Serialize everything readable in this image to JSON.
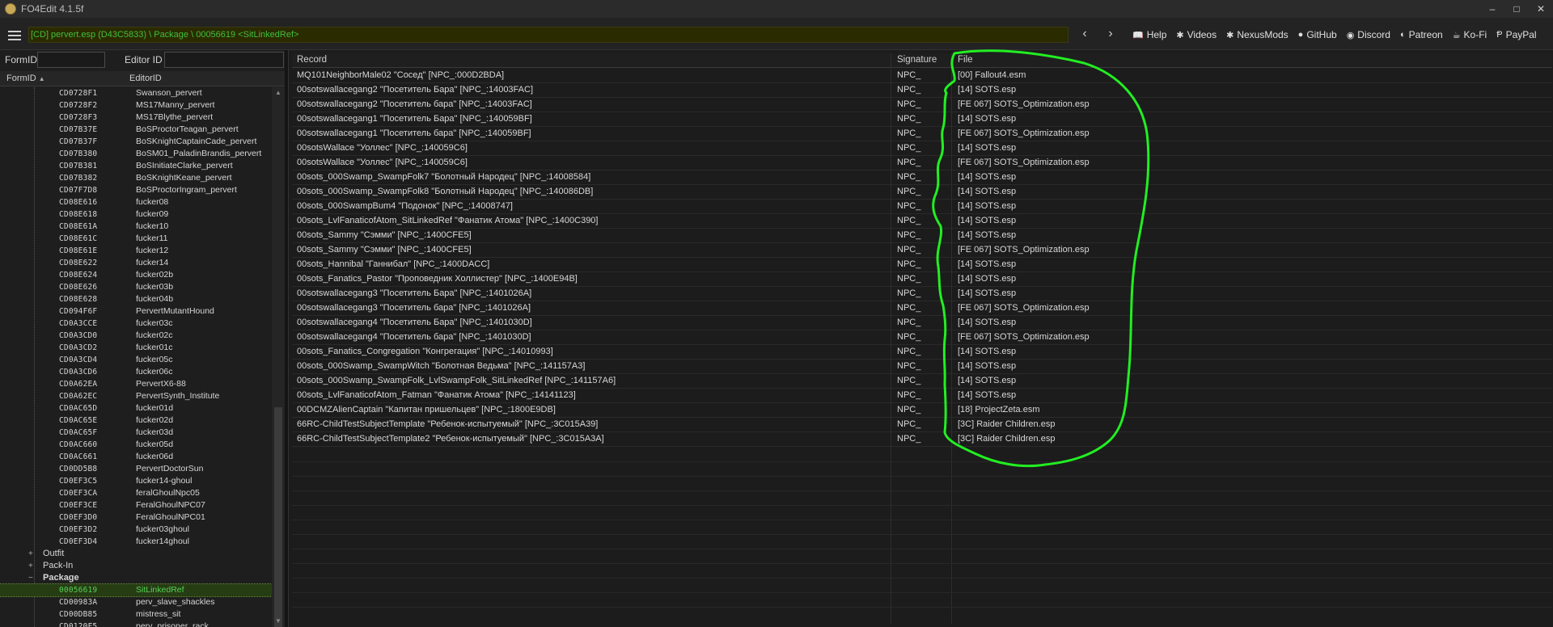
{
  "window": {
    "title": "FO4Edit 4.1.5f",
    "controls": [
      "–",
      "□",
      "✕"
    ]
  },
  "toolbar": {
    "path": "[CD] pervert.esp (D43C5833) \\ Package \\ 00056619 <SitLinkedRef>",
    "back_label": "‹",
    "forward_label": "›",
    "links": [
      {
        "label": "Help",
        "icon": "book-icon",
        "glyph": "📖"
      },
      {
        "label": "Videos",
        "icon": "video-icon",
        "glyph": "✱"
      },
      {
        "label": "NexusMods",
        "icon": "nexus-icon",
        "glyph": "✱"
      },
      {
        "label": "GitHub",
        "icon": "github-icon",
        "glyph": "●"
      },
      {
        "label": "Discord",
        "icon": "discord-icon",
        "glyph": "◉"
      },
      {
        "label": "Patreon",
        "icon": "patreon-icon",
        "glyph": "◐"
      },
      {
        "label": "Ko-Fi",
        "icon": "kofi-icon",
        "glyph": "☕"
      },
      {
        "label": "PayPal",
        "icon": "paypal-icon",
        "glyph": "Ᵽ"
      }
    ]
  },
  "filter": {
    "formid_label": "FormID",
    "editorid_label": "Editor ID",
    "formid_value": "",
    "editorid_value": ""
  },
  "tree": {
    "columns": [
      "FormID",
      "EditorID"
    ],
    "sort_glyph": "▲",
    "rows": [
      {
        "type": "rec",
        "fid": "CD0728F1",
        "eid": "Swanson_pervert"
      },
      {
        "type": "rec",
        "fid": "CD0728F2",
        "eid": "MS17Manny_pervert"
      },
      {
        "type": "rec",
        "fid": "CD0728F3",
        "eid": "MS17Blythe_pervert"
      },
      {
        "type": "rec",
        "fid": "CD07B37E",
        "eid": "BoSProctorTeagan_pervert"
      },
      {
        "type": "rec",
        "fid": "CD07B37F",
        "eid": "BoSKnightCaptainCade_pervert"
      },
      {
        "type": "rec",
        "fid": "CD07B380",
        "eid": "BoSM01_PaladinBrandis_pervert"
      },
      {
        "type": "rec",
        "fid": "CD07B381",
        "eid": "BoSInitiateClarke_pervert"
      },
      {
        "type": "rec",
        "fid": "CD07B382",
        "eid": "BoSKnightKeane_pervert"
      },
      {
        "type": "rec",
        "fid": "CD07F7D8",
        "eid": "BoSProctorIngram_pervert"
      },
      {
        "type": "rec",
        "fid": "CD08E616",
        "eid": "fucker08"
      },
      {
        "type": "rec",
        "fid": "CD08E618",
        "eid": "fucker09"
      },
      {
        "type": "rec",
        "fid": "CD08E61A",
        "eid": "fucker10"
      },
      {
        "type": "rec",
        "fid": "CD08E61C",
        "eid": "fucker11"
      },
      {
        "type": "rec",
        "fid": "CD08E61E",
        "eid": "fucker12"
      },
      {
        "type": "rec",
        "fid": "CD08E622",
        "eid": "fucker14"
      },
      {
        "type": "rec",
        "fid": "CD08E624",
        "eid": "fucker02b"
      },
      {
        "type": "rec",
        "fid": "CD08E626",
        "eid": "fucker03b"
      },
      {
        "type": "rec",
        "fid": "CD08E628",
        "eid": "fucker04b"
      },
      {
        "type": "rec",
        "fid": "CD094F6F",
        "eid": "PervertMutantHound"
      },
      {
        "type": "rec",
        "fid": "CD0A3CCE",
        "eid": "fucker03c"
      },
      {
        "type": "rec",
        "fid": "CD0A3CD0",
        "eid": "fucker02c"
      },
      {
        "type": "rec",
        "fid": "CD0A3CD2",
        "eid": "fucker01c"
      },
      {
        "type": "rec",
        "fid": "CD0A3CD4",
        "eid": "fucker05c"
      },
      {
        "type": "rec",
        "fid": "CD0A3CD6",
        "eid": "fucker06c"
      },
      {
        "type": "rec",
        "fid": "CD0A62EA",
        "eid": "PervertX6-88"
      },
      {
        "type": "rec",
        "fid": "CD0A62EC",
        "eid": "PervertSynth_Institute"
      },
      {
        "type": "rec",
        "fid": "CD0AC65D",
        "eid": "fucker01d"
      },
      {
        "type": "rec",
        "fid": "CD0AC65E",
        "eid": "fucker02d"
      },
      {
        "type": "rec",
        "fid": "CD0AC65F",
        "eid": "fucker03d"
      },
      {
        "type": "rec",
        "fid": "CD0AC660",
        "eid": "fucker05d"
      },
      {
        "type": "rec",
        "fid": "CD0AC661",
        "eid": "fucker06d"
      },
      {
        "type": "rec",
        "fid": "CD0DD5B8",
        "eid": "PervertDoctorSun"
      },
      {
        "type": "rec",
        "fid": "CD0EF3C5",
        "eid": "fucker14-ghoul"
      },
      {
        "type": "rec",
        "fid": "CD0EF3CA",
        "eid": "feralGhoulNpc05"
      },
      {
        "type": "rec",
        "fid": "CD0EF3CE",
        "eid": "FeralGhoulNPC07"
      },
      {
        "type": "rec",
        "fid": "CD0EF3D0",
        "eid": "FeralGhoulNPC01"
      },
      {
        "type": "rec",
        "fid": "CD0EF3D2",
        "eid": "fucker03ghoul"
      },
      {
        "type": "rec",
        "fid": "CD0EF3D4",
        "eid": "fucker14ghoul"
      },
      {
        "type": "group",
        "label": "Outfit",
        "exp": "+"
      },
      {
        "type": "group",
        "label": "Pack-In",
        "exp": "+"
      },
      {
        "type": "group",
        "label": "Package",
        "exp": "−"
      },
      {
        "type": "rec",
        "fid": "00056619",
        "eid": "SitLinkedRef",
        "selected": true
      },
      {
        "type": "rec",
        "fid": "CD00983A",
        "eid": "perv_slave_shackles"
      },
      {
        "type": "rec",
        "fid": "CD00DB85",
        "eid": "mistress_sit"
      },
      {
        "type": "rec",
        "fid": "CD0120F5",
        "eid": "perv_prisoner_rack"
      }
    ]
  },
  "grid": {
    "headers": {
      "record": "Record",
      "signature": "Signature",
      "file": "File"
    },
    "rows": [
      {
        "record": "MQ101NeighborMale02 \"Сосед\" [NPC_:000D2BDA]",
        "sig": "NPC_",
        "file": "[00] Fallout4.esm"
      },
      {
        "record": "00sotswallacegang2 \"Посетитель Бара\" [NPC_:14003FAC]",
        "sig": "NPC_",
        "file": "[14] SOTS.esp"
      },
      {
        "record": "00sotswallacegang2 \"Посетитель бара\" [NPC_:14003FAC]",
        "sig": "NPC_",
        "file": "[FE 067] SOTS_Optimization.esp"
      },
      {
        "record": "00sotswallacegang1 \"Посетитель Бара\" [NPC_:140059BF]",
        "sig": "NPC_",
        "file": "[14] SOTS.esp"
      },
      {
        "record": "00sotswallacegang1 \"Посетитель бара\" [NPC_:140059BF]",
        "sig": "NPC_",
        "file": "[FE 067] SOTS_Optimization.esp"
      },
      {
        "record": "00sotsWallace \"Уоллес\" [NPC_:140059C6]",
        "sig": "NPC_",
        "file": "[14] SOTS.esp"
      },
      {
        "record": "00sotsWallace \"Уоллес\" [NPC_:140059C6]",
        "sig": "NPC_",
        "file": "[FE 067] SOTS_Optimization.esp"
      },
      {
        "record": "00sots_000Swamp_SwampFolk7 \"Болотный Народец\" [NPC_:14008584]",
        "sig": "NPC_",
        "file": "[14] SOTS.esp"
      },
      {
        "record": "00sots_000Swamp_SwampFolk8 \"Болотный Народец\" [NPC_:140086DB]",
        "sig": "NPC_",
        "file": "[14] SOTS.esp"
      },
      {
        "record": "00sots_000SwampBum4 \"Подонок\" [NPC_:14008747]",
        "sig": "NPC_",
        "file": "[14] SOTS.esp"
      },
      {
        "record": "00sots_LvlFanaticofAtom_SitLinkedRef \"Фанатик Атома\" [NPC_:1400C390]",
        "sig": "NPC_",
        "file": "[14] SOTS.esp"
      },
      {
        "record": "00sots_Sammy \"Сэмми\" [NPC_:1400CFE5]",
        "sig": "NPC_",
        "file": "[14] SOTS.esp"
      },
      {
        "record": "00sots_Sammy \"Сэмми\" [NPC_:1400CFE5]",
        "sig": "NPC_",
        "file": "[FE 067] SOTS_Optimization.esp"
      },
      {
        "record": "00sots_Hannibal \"Ганнибал\" [NPC_:1400DACC]",
        "sig": "NPC_",
        "file": "[14] SOTS.esp"
      },
      {
        "record": "00sots_Fanatics_Pastor \"Проповедник Холлистер\" [NPC_:1400E94B]",
        "sig": "NPC_",
        "file": "[14] SOTS.esp"
      },
      {
        "record": "00sotswallacegang3 \"Посетитель Бара\" [NPC_:1401026A]",
        "sig": "NPC_",
        "file": "[14] SOTS.esp"
      },
      {
        "record": "00sotswallacegang3 \"Посетитель бара\" [NPC_:1401026A]",
        "sig": "NPC_",
        "file": "[FE 067] SOTS_Optimization.esp"
      },
      {
        "record": "00sotswallacegang4 \"Посетитель Бара\" [NPC_:1401030D]",
        "sig": "NPC_",
        "file": "[14] SOTS.esp"
      },
      {
        "record": "00sotswallacegang4 \"Посетитель бара\" [NPC_:1401030D]",
        "sig": "NPC_",
        "file": "[FE 067] SOTS_Optimization.esp"
      },
      {
        "record": "00sots_Fanatics_Congregation \"Конгрегация\" [NPC_:14010993]",
        "sig": "NPC_",
        "file": "[14] SOTS.esp"
      },
      {
        "record": "00sots_000Swamp_SwampWitch \"Болотная Ведьма\" [NPC_:141157A3]",
        "sig": "NPC_",
        "file": "[14] SOTS.esp"
      },
      {
        "record": "00sots_000Swamp_SwampFolk_LvlSwampFolk_SitLinkedRef [NPC_:141157A6]",
        "sig": "NPC_",
        "file": "[14] SOTS.esp"
      },
      {
        "record": "00sots_LvlFanaticofAtom_Fatman \"Фанатик Атома\" [NPC_:14141123]",
        "sig": "NPC_",
        "file": "[14] SOTS.esp"
      },
      {
        "record": "00DCMZAlienCaptain \"Капитан пришельцев\" [NPC_:1800E9DB]",
        "sig": "NPC_",
        "file": "[18] ProjectZeta.esm"
      },
      {
        "record": "66RC-ChildTestSubjectTemplate \"Ребенок-испытуемый\" [NPC_:3C015A39]",
        "sig": "NPC_",
        "file": "[3C] Raider Children.esp"
      },
      {
        "record": "66RC-ChildTestSubjectTemplate2 \"Ребенок-испытуемый\" [NPC_:3C015A3A]",
        "sig": "NPC_",
        "file": "[3C] Raider Children.esp"
      }
    ]
  },
  "colors": {
    "path_text": "#3fbf3f",
    "selection_text": "#56d056",
    "annotation_stroke": "#22ee22"
  }
}
